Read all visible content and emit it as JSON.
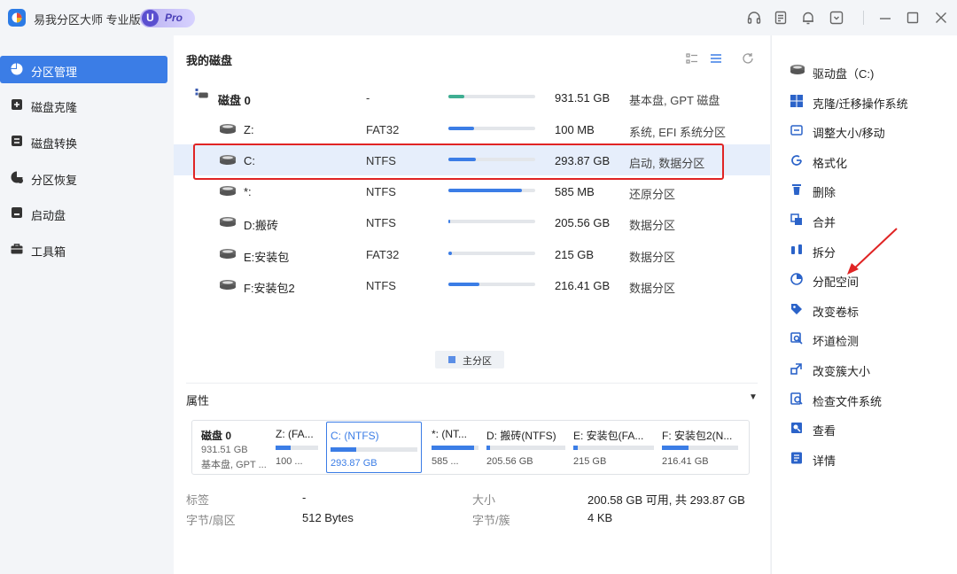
{
  "app": {
    "title": "易我分区大师 专业版",
    "pro_u": "U",
    "pro_label": "Pro"
  },
  "titlebar_icons": [
    "headset-icon",
    "note-icon",
    "bell-icon",
    "dropdown-box-icon",
    "minimize-icon",
    "maximize-icon",
    "close-icon"
  ],
  "sidebar": {
    "items": [
      {
        "label": "分区管理",
        "icon": "pie-chart-icon",
        "active": true
      },
      {
        "label": "磁盘克隆",
        "icon": "clone-icon",
        "active": false
      },
      {
        "label": "磁盘转换",
        "icon": "convert-icon",
        "active": false
      },
      {
        "label": "分区恢复",
        "icon": "recover-icon",
        "active": false
      },
      {
        "label": "启动盘",
        "icon": "boot-disk-icon",
        "active": false
      },
      {
        "label": "工具箱",
        "icon": "toolbox-icon",
        "active": false
      }
    ]
  },
  "main": {
    "title": "我的磁盘",
    "disk": {
      "name": "磁盘 0",
      "fs": "-",
      "size": "931.51 GB",
      "info": "基本盘, GPT 磁盘",
      "used": 0.18
    },
    "partitions": [
      {
        "name": "Z:",
        "fs": "FAT32",
        "size": "100 MB",
        "info": "系统, EFI 系统分区",
        "used": 0.3,
        "selected": false
      },
      {
        "name": "C:",
        "fs": "NTFS",
        "size": "293.87 GB",
        "info": "启动, 数据分区",
        "used": 0.32,
        "selected": true
      },
      {
        "name": "*:",
        "fs": "NTFS",
        "size": "585 MB",
        "info": "还原分区",
        "used": 0.85,
        "selected": false
      },
      {
        "name": "D:搬砖",
        "fs": "NTFS",
        "size": "205.56 GB",
        "info": "数据分区",
        "used": 0.02,
        "selected": false
      },
      {
        "name": "E:安装包",
        "fs": "FAT32",
        "size": "215 GB",
        "info": "数据分区",
        "used": 0.04,
        "selected": false
      },
      {
        "name": "F:安装包2",
        "fs": "NTFS",
        "size": "216.41 GB",
        "info": "数据分区",
        "used": 0.36,
        "selected": false
      }
    ],
    "legend": "主分区",
    "properties_title": "属性",
    "strip": {
      "disk": {
        "name": "磁盘 0",
        "size": "931.51 GB",
        "type": "基本盘, GPT ..."
      },
      "cells": [
        {
          "title": "Z: (FA...",
          "value": "100 ...",
          "used": 0.35
        },
        {
          "title": "C: (NTFS)",
          "value": "293.87 GB",
          "used": 0.3
        },
        {
          "title": "*: (NT...",
          "value": "585 ...",
          "used": 0.9
        },
        {
          "title": "D: 搬砖(NTFS)",
          "value": "205.56 GB",
          "used": 0.05
        },
        {
          "title": "E: 安装包(FA...",
          "value": "215 GB",
          "used": 0.05
        },
        {
          "title": "F: 安装包2(N...",
          "value": "216.41 GB",
          "used": 0.35
        }
      ]
    },
    "props": {
      "label_k": "标签",
      "label_v": "-",
      "sector_k": "字节/扇区",
      "sector_v": "512 Bytes",
      "size_k": "大小",
      "size_v": "200.58 GB 可用, 共 293.87 GB",
      "cluster_k": "字节/簇",
      "cluster_v": "4 KB"
    }
  },
  "actions": [
    {
      "label": "驱动盘（C:)",
      "icon": "drive-icon"
    },
    {
      "label": "克隆/迁移操作系统",
      "icon": "windows-icon"
    },
    {
      "label": "调整大小/移动",
      "icon": "resize-icon"
    },
    {
      "label": "格式化",
      "icon": "format-icon"
    },
    {
      "label": "删除",
      "icon": "trash-icon"
    },
    {
      "label": "合并",
      "icon": "merge-icon"
    },
    {
      "label": "拆分",
      "icon": "split-icon"
    },
    {
      "label": "分配空间",
      "icon": "allocate-icon"
    },
    {
      "label": "改变卷标",
      "icon": "tag-icon"
    },
    {
      "label": "坏道检测",
      "icon": "scan-icon"
    },
    {
      "label": "改变簇大小",
      "icon": "cluster-icon"
    },
    {
      "label": "检查文件系统",
      "icon": "check-fs-icon"
    },
    {
      "label": "查看",
      "icon": "view-icon"
    },
    {
      "label": "详情",
      "icon": "details-icon"
    }
  ],
  "colors": {
    "accent": "#3b7de6",
    "annotation": "#e02424"
  }
}
